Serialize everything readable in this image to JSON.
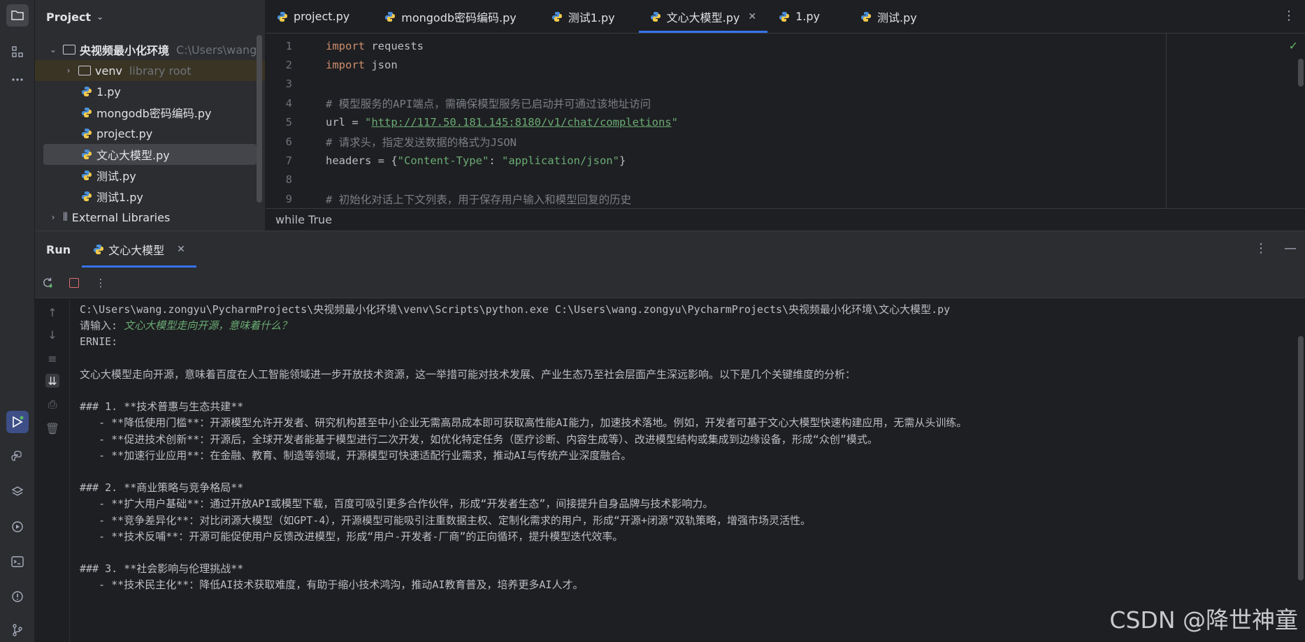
{
  "project": {
    "title": "Project",
    "root": {
      "name": "央视频最小化环境",
      "path": "C:\\Users\\wang."
    },
    "venv": {
      "name": "venv",
      "hint": "library root"
    },
    "files": [
      "1.py",
      "mongodb密码编码.py",
      "project.py",
      "文心大模型.py",
      "测试.py",
      "测试1.py"
    ],
    "external": "External Libraries"
  },
  "tabs": [
    {
      "label": "project.py"
    },
    {
      "label": "mongodb密码编码.py"
    },
    {
      "label": "测试1.py"
    },
    {
      "label": "文心大模型.py"
    },
    {
      "label": "1.py"
    },
    {
      "label": "测试.py"
    }
  ],
  "editor": {
    "line_numbers": [
      "1",
      "2",
      "3",
      "4",
      "5",
      "6",
      "7",
      "8",
      "9"
    ],
    "l1_kw": "import",
    "l1_rest": " requests",
    "l2_kw": "import",
    "l2_rest": " json",
    "l4": "# 模型服务的API端点，需确保模型服务已启动并可通过该地址访问",
    "l5_a": "url = ",
    "l5_q1": "\"",
    "l5_url": "http://117.50.181.145:8180/v1/chat/completions",
    "l5_q2": "\"",
    "l6": "# 请求头，指定发送数据的格式为JSON",
    "l7_a": "headers = {",
    "l7_k": "\"Content-Type\"",
    "l7_b": ": ",
    "l7_v": "\"application/json\"",
    "l7_c": "}",
    "l9": "# 初始化对话上下文列表，用于保存用户输入和模型回复的历史",
    "breadcrumb": "while True"
  },
  "run": {
    "title": "Run",
    "tab": "文心大模型",
    "cmd": "C:\\Users\\wang.zongyu\\PycharmProjects\\央视频最小化环境\\venv\\Scripts\\python.exe C:\\Users\\wang.zongyu\\PycharmProjects\\央视频最小化环境\\文心大模型.py",
    "prompt": "请输入: ",
    "user_input": "文心大模型走向开源，意味着什么？",
    "ernie": "ERNIE:",
    "intro": "文心大模型走向开源，意味着百度在人工智能领域进一步开放技术资源，这一举措可能对技术发展、产业生态乃至社会层面产生深远影响。以下是几个关键维度的分析：",
    "h1": "### 1. **技术普惠与生态共建**",
    "h1_items": [
      "   - **降低使用门槛**：开源模型允许开发者、研究机构甚至中小企业无需高昂成本即可获取高性能AI能力，加速技术落地。例如，开发者可基于文心大模型快速构建应用，无需从头训练。",
      "   - **促进技术创新**：开源后，全球开发者能基于模型进行二次开发，如优化特定任务（医疗诊断、内容生成等）、改进模型结构或集成到边缘设备，形成“众创”模式。",
      "   - **加速行业应用**：在金融、教育、制造等领域，开源模型可快速适配行业需求，推动AI与传统产业深度融合。"
    ],
    "h2": "### 2. **商业策略与竞争格局**",
    "h2_items": [
      "   - **扩大用户基础**：通过开放API或模型下载，百度可吸引更多合作伙伴，形成“开发者生态”，间接提升自身品牌与技术影响力。",
      "   - **竞争差异化**：对比闭源大模型（如GPT-4），开源模型可能吸引注重数据主权、定制化需求的用户，形成“开源+闭源”双轨策略，增强市场灵活性。",
      "   - **技术反哺**：开源可能促使用户反馈改进模型，形成“用户-开发者-厂商”的正向循环，提升模型迭代效率。"
    ],
    "h3": "### 3. **社会影响与伦理挑战**",
    "h3_items": [
      "   - **技术民主化**：降低AI技术获取难度，有助于缩小技术鸿沟，推动AI教育普及，培养更多AI人才。"
    ]
  },
  "watermark": "CSDN @降世神童",
  "colors": {
    "accent": "#3574f0",
    "keyword": "#cf8e6d",
    "string": "#6aab73",
    "comment": "#7a7e85"
  }
}
